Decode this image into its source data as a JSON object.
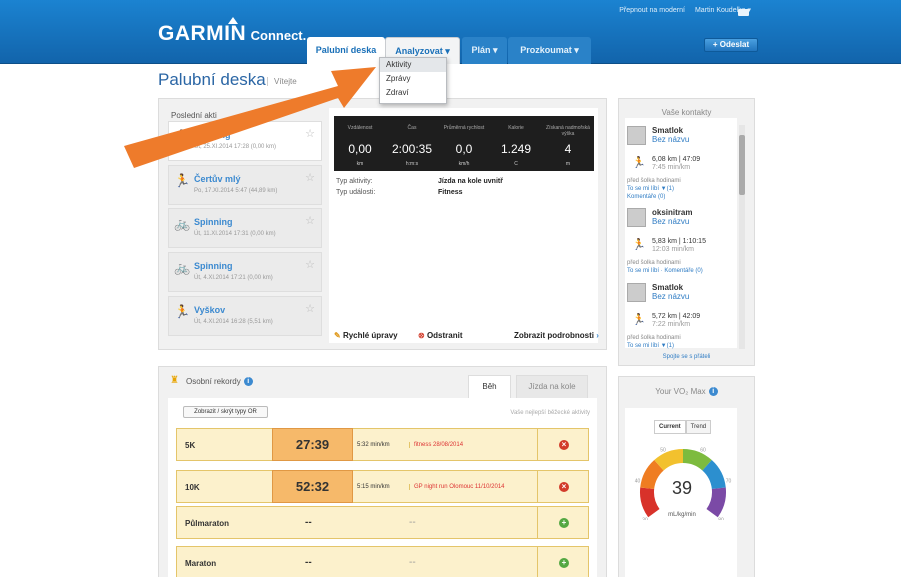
{
  "header": {
    "top_links": [
      "Přepnout na moderní",
      "Martin Koudelka ▾"
    ],
    "logo": "GARMIN",
    "logo_suffix": "Connect.",
    "tabs": [
      "Palubní deska",
      "Analyzovat ▾",
      "Plán ▾",
      "Prozkoumat ▾"
    ],
    "add_button": "+ Odeslat"
  },
  "page": {
    "title": "Palubní deska",
    "welcome": "Vítejte"
  },
  "analyze_menu": [
    "Aktivity",
    "Zprávy",
    "Zdraví"
  ],
  "last_activities": {
    "title": "Poslední akti",
    "items": [
      {
        "name": "Running",
        "date": "Út, 25.XI.2014 17:28 (0,00 km)",
        "icon": "runner-icon"
      },
      {
        "name": "Čertův mlý",
        "date": "Po, 17.XI.2014 5:47 (44,89 km)",
        "icon": "runner-icon"
      },
      {
        "name": "Spinning",
        "date": "Út, 11.XI.2014 17:31 (0,00 km)",
        "icon": "bike-icon"
      },
      {
        "name": "Spinning",
        "date": "Út, 4.XI.2014 17:21 (0,00 km)",
        "icon": "bike-icon"
      },
      {
        "name": "Vyškov",
        "date": "Út, 4.XI.2014 16:28 (5,51 km)",
        "icon": "runner-icon"
      }
    ]
  },
  "stats": [
    {
      "label": "Vzdálenost",
      "value": "0,00",
      "unit": "km"
    },
    {
      "label": "Čas",
      "value": "2:00:35",
      "unit": "h:m:s"
    },
    {
      "label": "Průměrná rychlost",
      "value": "0,0",
      "unit": "km/h"
    },
    {
      "label": "Kalorie",
      "value": "1.249",
      "unit": "C"
    },
    {
      "label": "Získaná nadmořská výška",
      "value": "4",
      "unit": "m"
    }
  ],
  "activity_info": {
    "type_label": "Typ aktivity:",
    "type_value": "Jízda na kole uvnitř",
    "event_label": "Typ události:",
    "event_value": "Fitness"
  },
  "activity_actions": {
    "edit": "Rychlé úpravy",
    "delete": "Odstranit",
    "details": "Zobrazit podrobnosti"
  },
  "contacts": {
    "title": "Vaše kontakty",
    "connect": "Spojte se s přáteli",
    "items": [
      {
        "name": "Smatlok",
        "subtitle": "Bez názvu",
        "stats": "6,08 km | 47:09",
        "pace": "7:45 min/km",
        "ago": "před šolka hodinami",
        "links": "To se mi líbí ▼(1)",
        "links2": "Komentáře (0)"
      },
      {
        "name": "oksinitram",
        "subtitle": "Bez názvu",
        "stats": "5,83 km | 1:10:15",
        "pace": "12:03 min/km",
        "ago": "před šolka hodinami",
        "links": "To se mi líbí · Komentáře (0)",
        "links2": ""
      },
      {
        "name": "Smatlok",
        "subtitle": "Bez názvu",
        "stats": "5,72 km | 42:09",
        "pace": "7:22 min/km",
        "ago": "před šolka hodinami",
        "links": "To se mi líbí ▼(1)",
        "links2": ""
      }
    ]
  },
  "records": {
    "title": "Osobní rekordy",
    "tabs": [
      "Běh",
      "Jízda na kole"
    ],
    "toggle": "Zobrazit / skrýt typy OR",
    "note": "Vaše nejlepší běžecké aktivity",
    "rows": [
      {
        "name": "5K",
        "time": "27:39",
        "pace": "5:32 min/km",
        "event": "fitness 28/08/2014",
        "has": true
      },
      {
        "name": "10K",
        "time": "52:32",
        "pace": "5:15 min/km",
        "event": "GP night run Olomouc 11/10/2014",
        "has": true
      },
      {
        "name": "Půlmaraton",
        "time": "--",
        "pace": "",
        "event": "--",
        "has": false
      },
      {
        "name": "Maraton",
        "time": "--",
        "pace": "",
        "event": "--",
        "has": false
      }
    ]
  },
  "vo2": {
    "title": "Your VO₂ Max",
    "tabs": [
      "Current",
      "Trend"
    ],
    "value": "39",
    "unit": "mL/kg/min",
    "ticks": [
      "30",
      "40",
      "50",
      "60",
      "70",
      "80"
    ],
    "colors": [
      "#d8322a",
      "#ef7d22",
      "#f2c12e",
      "#7dbb3e",
      "#2c8fcf",
      "#7b4aa6"
    ]
  }
}
